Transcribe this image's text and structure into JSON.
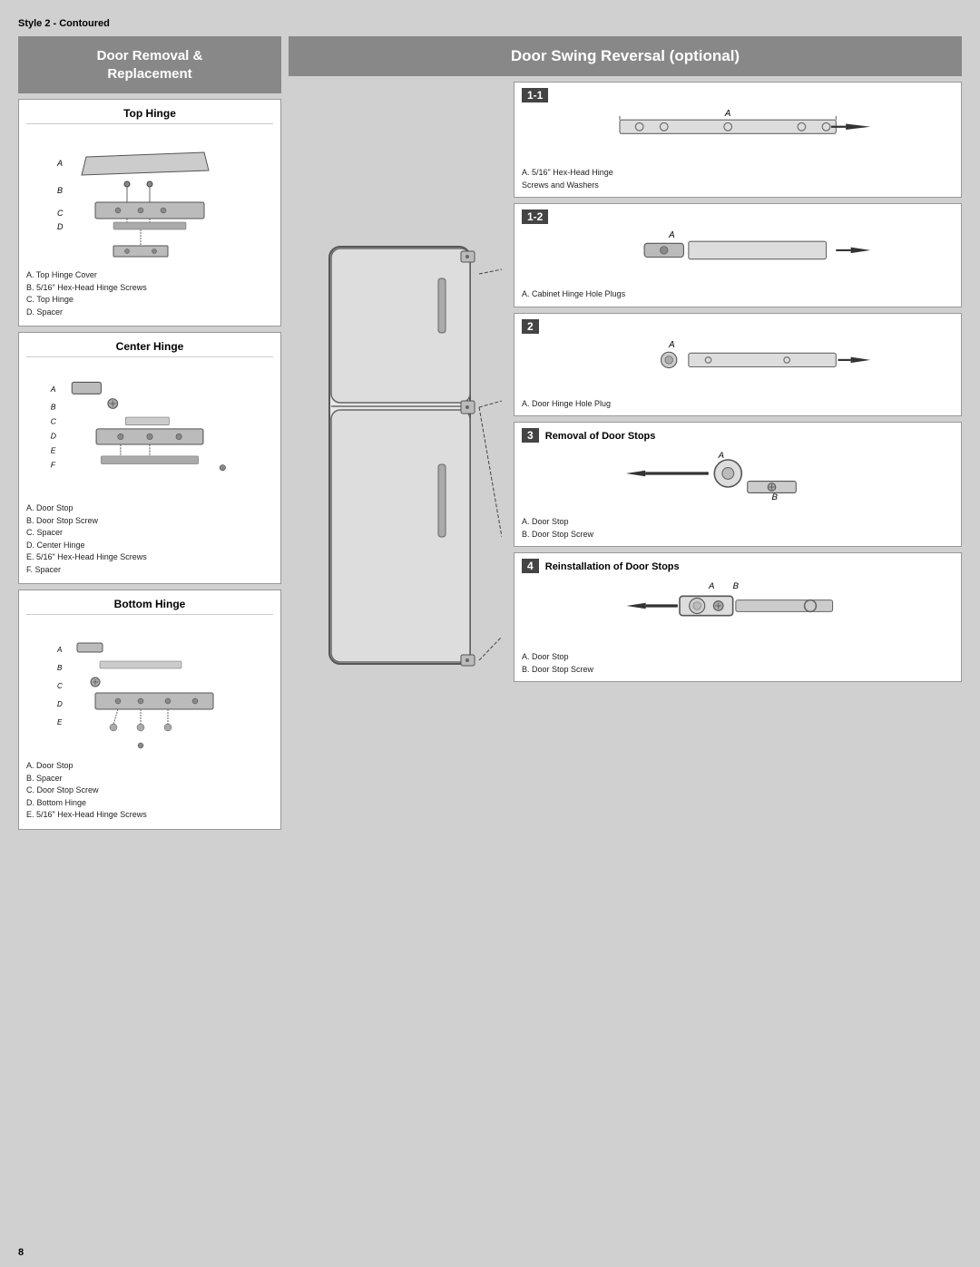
{
  "page": {
    "style_label": "Style 2 - Contoured",
    "page_number": "8"
  },
  "left": {
    "header": "Door Removal &\nReplacement",
    "hinges": [
      {
        "id": "top-hinge",
        "title": "Top Hinge",
        "notes": [
          "A. Top Hinge Cover",
          "B. 5/16\" Hex-Head Hinge Screws",
          "C. Top Hinge",
          "D. Spacer"
        ]
      },
      {
        "id": "center-hinge",
        "title": "Center Hinge",
        "notes": [
          "A. Door Stop",
          "B. Door Stop Screw",
          "C. Spacer",
          "D. Center Hinge",
          "E. 5/16\" Hex-Head Hinge Screws",
          "F. Spacer"
        ]
      },
      {
        "id": "bottom-hinge",
        "title": "Bottom Hinge",
        "notes": [
          "A. Door Stop",
          "B. Spacer",
          "C. Door Stop Screw",
          "D. Bottom Hinge",
          "E. 5/16\" Hex-Head Hinge Screws"
        ]
      }
    ]
  },
  "right": {
    "header": "Door Swing Reversal (optional)",
    "steps": [
      {
        "id": "step-1-1",
        "badge": "1-1",
        "title": "",
        "notes": [
          "A. 5/16\" Hex-Head Hinge",
          "Screws and Washers"
        ]
      },
      {
        "id": "step-1-2",
        "badge": "1-2",
        "title": "",
        "notes": [
          "A. Cabinet Hinge Hole Plugs"
        ]
      },
      {
        "id": "step-2",
        "badge": "2",
        "title": "",
        "notes": [
          "A. Door Hinge Hole Plug"
        ]
      },
      {
        "id": "step-3",
        "badge": "3",
        "title": "Removal of Door Stops",
        "notes": [
          "A. Door Stop",
          "B. Door Stop Screw"
        ]
      },
      {
        "id": "step-4",
        "badge": "4",
        "title": "Reinstallation of Door Stops",
        "notes": [
          "A. Door Stop",
          "B. Door Stop Screw"
        ]
      }
    ]
  }
}
